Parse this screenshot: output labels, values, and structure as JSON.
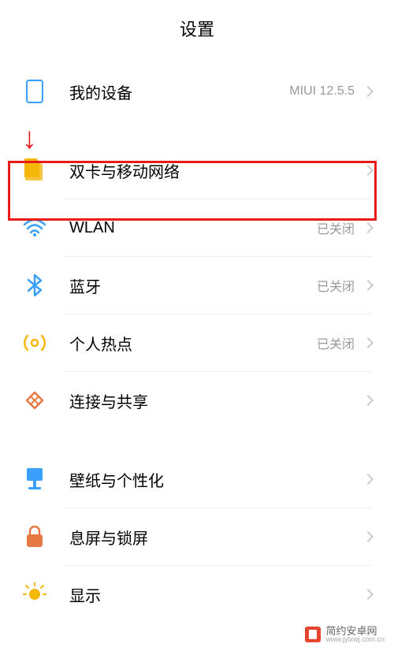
{
  "header": {
    "title": "设置"
  },
  "items": {
    "device": {
      "label": "我的设备",
      "value": "MIUI 12.5.5"
    },
    "sim": {
      "label": "双卡与移动网络",
      "value": ""
    },
    "wlan": {
      "label": "WLAN",
      "value": "已关闭"
    },
    "bluetooth": {
      "label": "蓝牙",
      "value": "已关闭"
    },
    "hotspot": {
      "label": "个人热点",
      "value": "已关闭"
    },
    "share": {
      "label": "连接与共享",
      "value": ""
    },
    "wallpaper": {
      "label": "壁纸与个性化",
      "value": ""
    },
    "lockscreen": {
      "label": "息屏与锁屏",
      "value": ""
    },
    "display": {
      "label": "显示",
      "value": ""
    }
  },
  "watermark": {
    "title": "简约安卓网",
    "url": "www.jylxwj.com.cn"
  }
}
